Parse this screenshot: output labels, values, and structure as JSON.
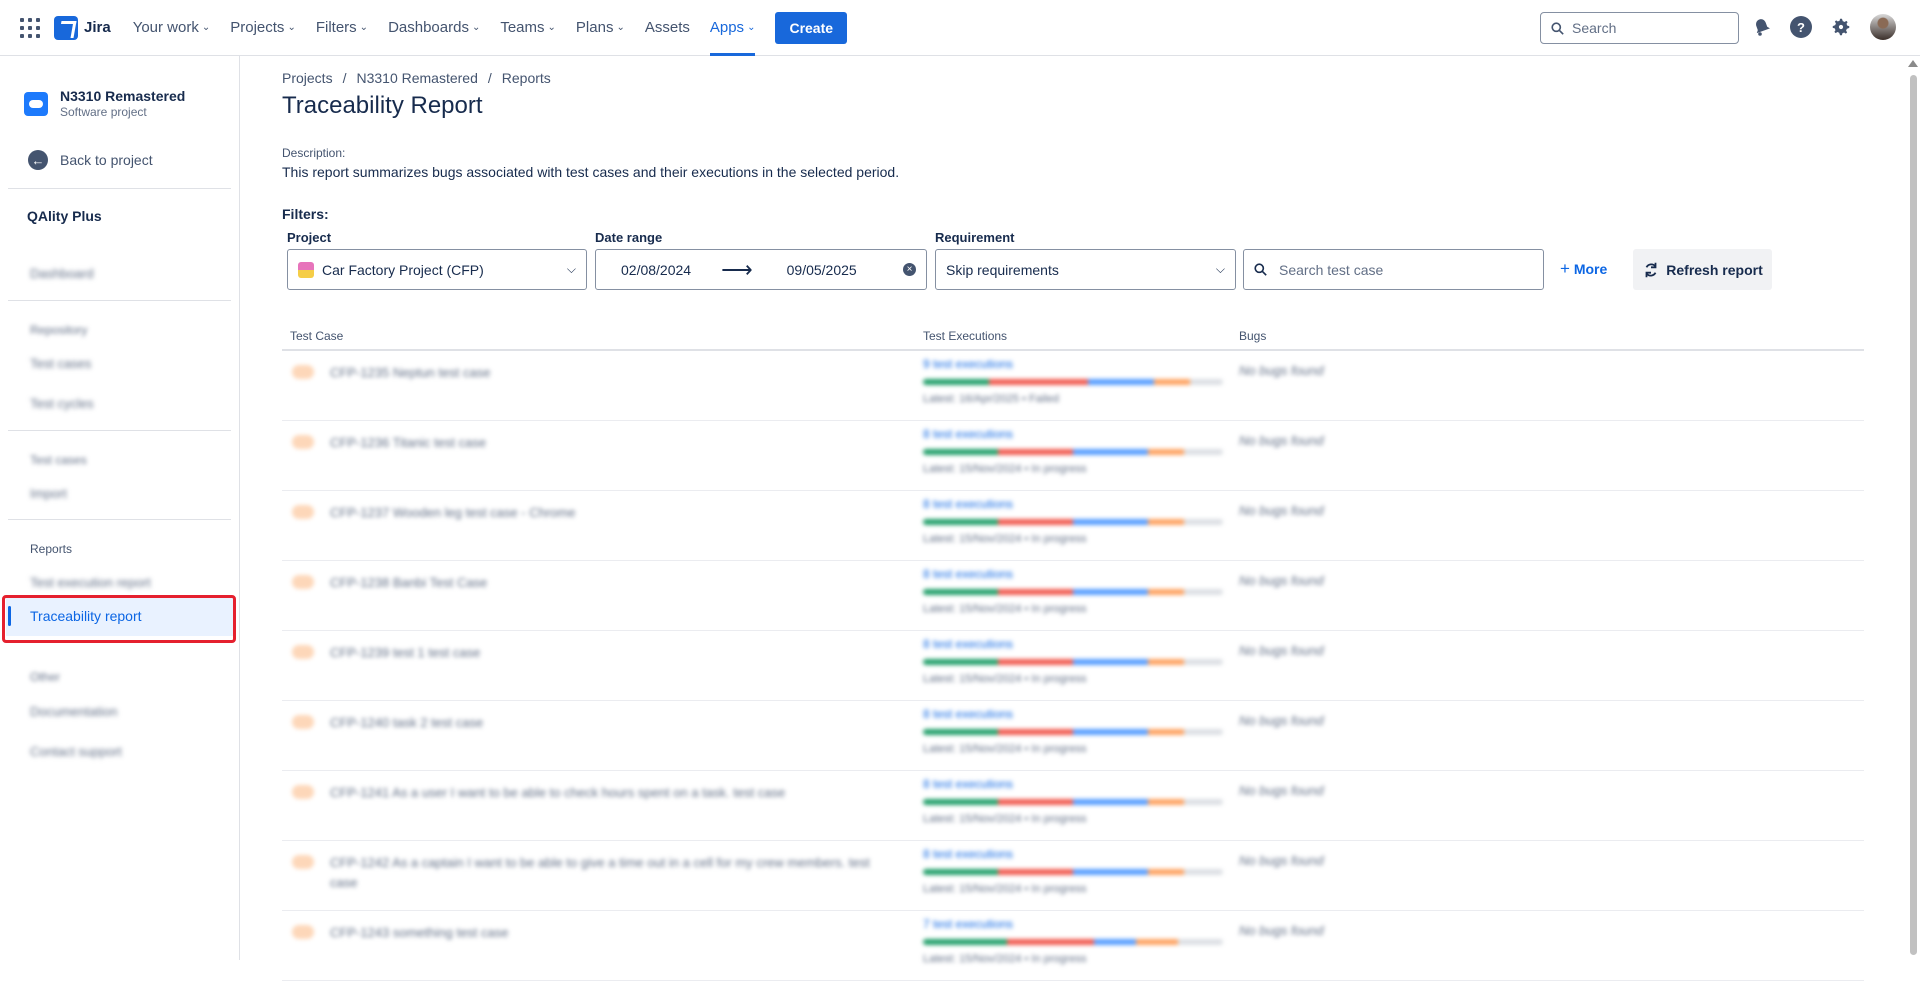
{
  "topnav": {
    "logo": "Jira",
    "items": [
      {
        "label": "Your work",
        "chevron": true
      },
      {
        "label": "Projects",
        "chevron": true
      },
      {
        "label": "Filters",
        "chevron": true
      },
      {
        "label": "Dashboards",
        "chevron": true
      },
      {
        "label": "Teams",
        "chevron": true
      },
      {
        "label": "Plans",
        "chevron": true
      },
      {
        "label": "Assets",
        "chevron": false
      },
      {
        "label": "Apps",
        "chevron": true,
        "active": true
      }
    ],
    "create_label": "Create",
    "search_placeholder": "Search",
    "accent": "#1868db"
  },
  "sidebar": {
    "project_name": "N3310 Remastered",
    "project_type": "Software project",
    "back_label": "Back to project",
    "app_name": "QAlity Plus",
    "dashboard": "Dashboard",
    "section_repository": "Repository",
    "test_cases": "Test cases",
    "test_cycles": "Test cycles",
    "section_test_cases": "Test cases",
    "import": "Import",
    "section_reports": "Reports",
    "test_execution_report": "Test execution report",
    "traceability_report": "Traceability report",
    "section_other": "Other",
    "documentation": "Documentation",
    "contact_support": "Contact support"
  },
  "breadcrumbs": [
    "Projects",
    "/",
    "N3310 Remastered",
    "/",
    "Reports"
  ],
  "page": {
    "title": "Traceability Report",
    "description_label": "Description:",
    "description": "This report summarizes bugs associated with test cases and their executions in the selected period.",
    "filters_label": "Filters:"
  },
  "filters": {
    "project_label": "Project",
    "project_value": "Car Factory Project (CFP)",
    "date_label": "Date range",
    "date_from": "02/08/2024",
    "date_arrow": "⟶",
    "date_to": "09/05/2025",
    "requirement_label": "Requirement",
    "requirement_value": "Skip requirements",
    "search_placeholder": "Search test case",
    "more_label": "More",
    "refresh_label": "Refresh report"
  },
  "table": {
    "columns": [
      "Test Case",
      "Test Executions",
      "Bugs"
    ],
    "rows": [
      {
        "test_case": "CFP-1235 Neptun test case",
        "executions": "9 test executions",
        "latest": "Latest: 16/Apr/2025 • Failed",
        "bugs": "No bugs found",
        "bar": [
          0.22,
          0.33,
          0.22,
          0.12
        ]
      },
      {
        "test_case": "CFP-1236 Titanic test case",
        "executions": "8 test executions",
        "latest": "Latest: 15/Nov/2024 • In progress",
        "bugs": "No bugs found",
        "bar": [
          0.25,
          0.25,
          0.25,
          0.12
        ]
      },
      {
        "test_case": "CFP-1237 Wooden leg test case - Chrome",
        "executions": "8 test executions",
        "latest": "Latest: 15/Nov/2024 • In progress",
        "bugs": "No bugs found",
        "bar": [
          0.25,
          0.25,
          0.25,
          0.12
        ]
      },
      {
        "test_case": "CFP-1238 Banbi Test Case",
        "executions": "8 test executions",
        "latest": "Latest: 15/Nov/2024 • In progress",
        "bugs": "No bugs found",
        "bar": [
          0.25,
          0.25,
          0.25,
          0.12
        ]
      },
      {
        "test_case": "CFP-1239 test 1 test case",
        "executions": "8 test executions",
        "latest": "Latest: 15/Nov/2024 • In progress",
        "bugs": "No bugs found",
        "bar": [
          0.25,
          0.25,
          0.25,
          0.12
        ]
      },
      {
        "test_case": "CFP-1240 task 2 test case",
        "executions": "8 test executions",
        "latest": "Latest: 15/Nov/2024 • In progress",
        "bugs": "No bugs found",
        "bar": [
          0.25,
          0.25,
          0.25,
          0.12
        ]
      },
      {
        "test_case": "CFP-1241 As a user I want to be able to check hours spent on a task. test case",
        "executions": "8 test executions",
        "latest": "Latest: 15/Nov/2024 • In progress",
        "bugs": "No bugs found",
        "bar": [
          0.25,
          0.25,
          0.25,
          0.12
        ]
      },
      {
        "test_case": "CFP-1242 As a captain I want to be able to give a time out in a cell for my crew members. test case",
        "executions": "8 test executions",
        "latest": "Latest: 15/Nov/2024 • In progress",
        "bugs": "No bugs found",
        "bar": [
          0.25,
          0.25,
          0.25,
          0.12
        ]
      },
      {
        "test_case": "CFP-1243 something test case",
        "executions": "7 test executions",
        "latest": "Latest: 15/Nov/2024 • In progress",
        "bugs": "No bugs found",
        "bar": [
          0.28,
          0.29,
          0.14,
          0.14
        ]
      }
    ]
  },
  "status_colors": {
    "passed": "#22a06b",
    "failed": "#f15b50",
    "in_progress": "#579dff",
    "todo": "#fea362"
  }
}
